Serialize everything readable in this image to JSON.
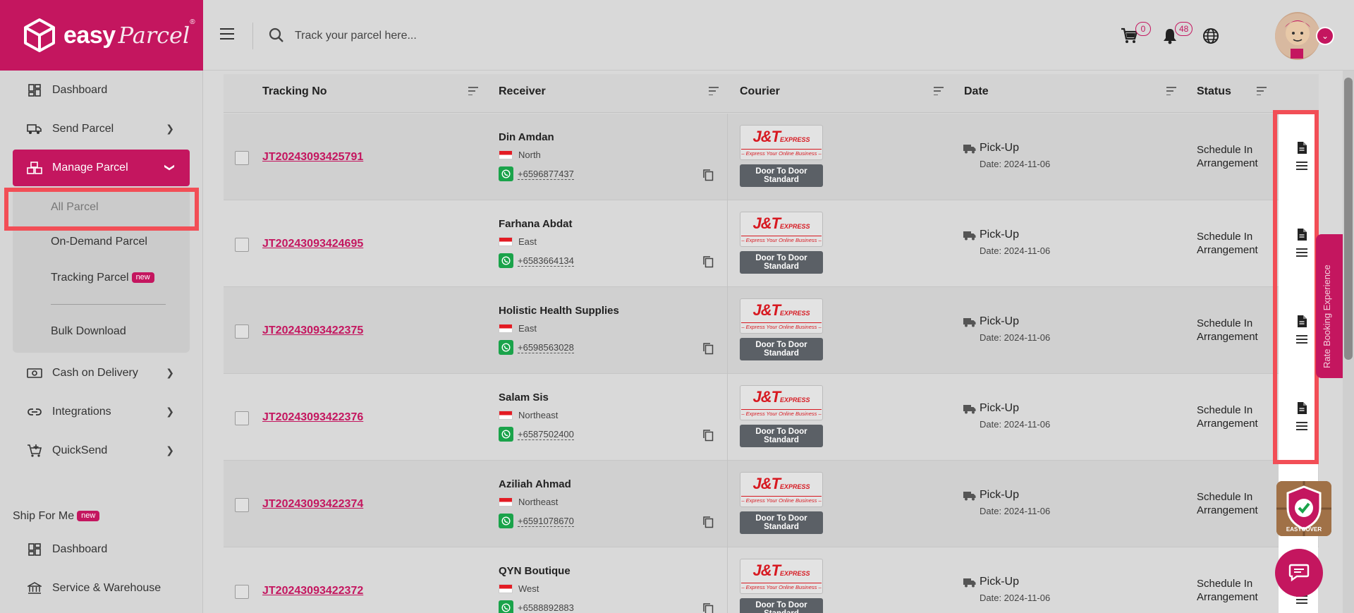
{
  "brand": {
    "name": "easy",
    "script": "Parcel",
    "reg": "®"
  },
  "search": {
    "placeholder": "Track your parcel here..."
  },
  "header": {
    "cart_count": "0",
    "notification_count": "48"
  },
  "sidebar": {
    "items": [
      {
        "label": "Dashboard",
        "icon": "dashboard-icon"
      },
      {
        "label": "Send Parcel",
        "icon": "truck-icon"
      },
      {
        "label": "Manage Parcel",
        "icon": "boxes-icon"
      },
      {
        "label": "Cash on Delivery",
        "icon": "cash-icon"
      },
      {
        "label": "Integrations",
        "icon": "link-icon"
      },
      {
        "label": "QuickSend",
        "icon": "cart-plus-icon"
      }
    ],
    "submenu": {
      "all_parcel": "All Parcel",
      "on_demand": "On-Demand Parcel",
      "tracking": "Tracking Parcel",
      "tracking_badge": "new",
      "bulk_download": "Bulk Download"
    },
    "ship_for_me": {
      "label": "Ship For Me",
      "badge": "new",
      "dashboard": "Dashboard",
      "service": "Service & Warehouse"
    }
  },
  "table": {
    "headers": {
      "tracking": "Tracking No",
      "receiver": "Receiver",
      "courier": "Courier",
      "date": "Date",
      "status": "Status"
    },
    "courier_brand": {
      "main": "J&T",
      "sub": "EXPRESS",
      "tagline": "Express Your Online Business"
    },
    "rows": [
      {
        "tracking": "JT20243093425791",
        "name": "Din Amdan",
        "region": "North",
        "phone": "+6596877437",
        "service_l1": "Door To Door",
        "service_l2": "Standard",
        "date_type": "Pick-Up",
        "date": "Date: 2024-11-06",
        "status_l1": "Schedule In",
        "status_l2": "Arrangement"
      },
      {
        "tracking": "JT20243093424695",
        "name": "Farhana Abdat",
        "region": "East",
        "phone": "+6583664134",
        "service_l1": "Door To Door",
        "service_l2": "Standard",
        "date_type": "Pick-Up",
        "date": "Date: 2024-11-06",
        "status_l1": "Schedule In",
        "status_l2": "Arrangement"
      },
      {
        "tracking": "JT20243093422375",
        "name": "Holistic Health Supplies",
        "region": "East",
        "phone": "+6598563028",
        "service_l1": "Door To Door",
        "service_l2": "Standard",
        "date_type": "Pick-Up",
        "date": "Date: 2024-11-06",
        "status_l1": "Schedule In",
        "status_l2": "Arrangement"
      },
      {
        "tracking": "JT20243093422376",
        "name": "Salam Sis",
        "region": "Northeast",
        "phone": "+6587502400",
        "service_l1": "Door To Door",
        "service_l2": "Standard",
        "date_type": "Pick-Up",
        "date": "Date: 2024-11-06",
        "status_l1": "Schedule In",
        "status_l2": "Arrangement"
      },
      {
        "tracking": "JT20243093422374",
        "name": "Aziliah Ahmad",
        "region": "Northeast",
        "phone": "+6591078670",
        "service_l1": "Door To Door",
        "service_l2": "Standard",
        "date_type": "Pick-Up",
        "date": "Date: 2024-11-06",
        "status_l1": "Schedule In",
        "status_l2": "Arrangement"
      },
      {
        "tracking": "JT20243093422372",
        "name": "QYN Boutique",
        "region": "West",
        "phone": "+6588892883",
        "service_l1": "Door To Door",
        "service_l2": "Standard",
        "date_type": "Pick-Up",
        "date": "Date: 2024-11-06",
        "status_l1": "Schedule In",
        "status_l2": "Arrangement"
      }
    ]
  },
  "feedback": {
    "label": "Rate Booking Experience"
  },
  "easycover": {
    "label": "EASYCOVER"
  },
  "colors": {
    "brand": "#c4165f",
    "highlight": "#f24e56",
    "whatsapp": "#1aa34a",
    "jt_red": "#d71921"
  }
}
